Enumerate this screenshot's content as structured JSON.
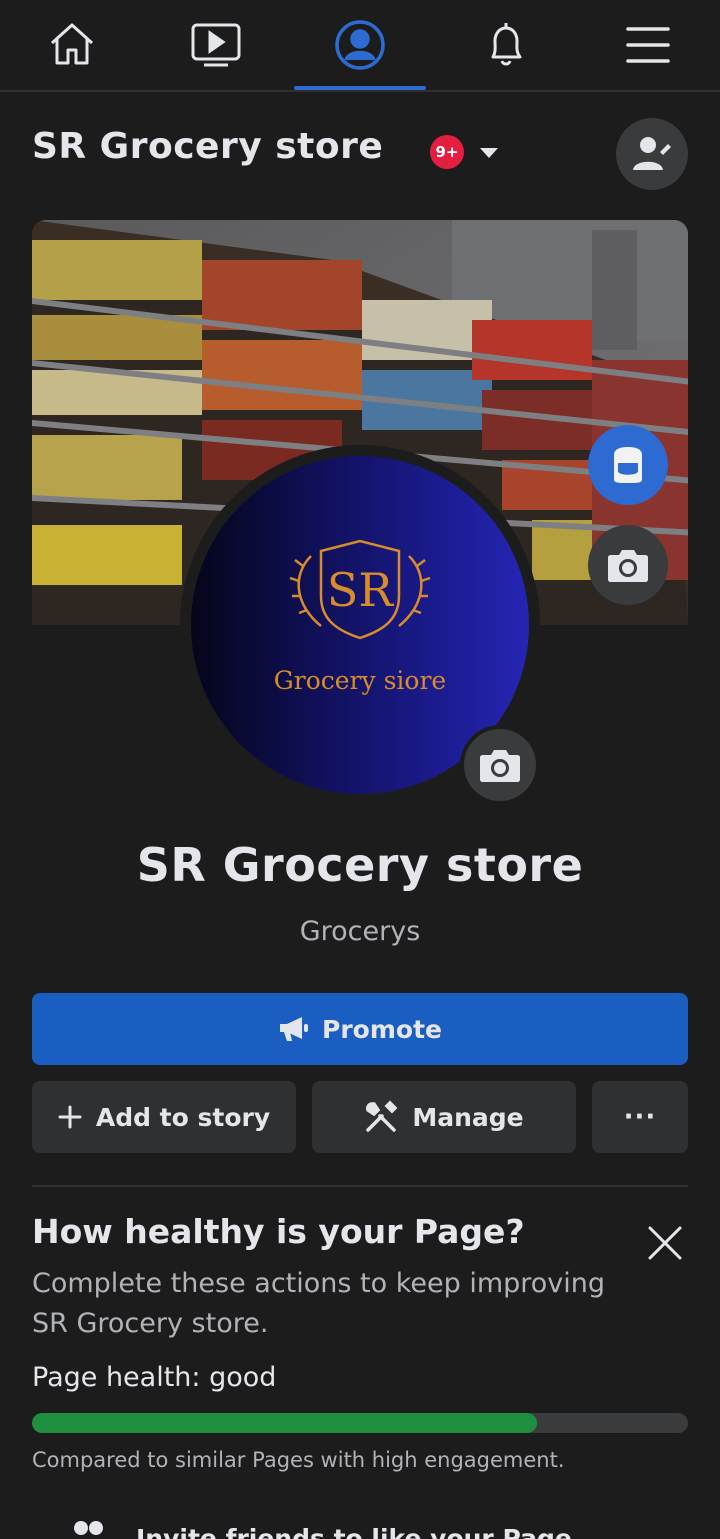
{
  "nav": {
    "items": [
      {
        "icon": "home-icon",
        "active": false
      },
      {
        "icon": "watch-video-icon",
        "active": false
      },
      {
        "icon": "profile-icon",
        "active": true
      },
      {
        "icon": "notifications-bell-icon",
        "active": false
      },
      {
        "icon": "menu-hamburger-icon",
        "active": false
      }
    ],
    "active_color": "#2d6bd3"
  },
  "header": {
    "page_name": "SR Grocery store",
    "notification_badge": "9+",
    "switch_profile_icon": "person-switch-icon"
  },
  "cover": {
    "description_icon": "avatar-icon",
    "camera_icon": "camera-icon"
  },
  "profile": {
    "logo_monogram": "SR",
    "logo_text": "Grocery siore",
    "title": "SR Grocery store",
    "category": "Grocerys",
    "camera_icon": "camera-icon"
  },
  "actions": {
    "promote_label": "Promote",
    "add_story_label": "Add to story",
    "manage_label": "Manage",
    "more_label": "···"
  },
  "health": {
    "title": "How healthy is your Page?",
    "description": "Complete these actions to keep improving SR Grocery store.",
    "status": "Page health:  good",
    "progress": 0.77,
    "compare_text": "Compared to similar Pages with high engagement.",
    "invite_text": "Invite friends to like your Page"
  },
  "colors": {
    "background": "#1c1c1d",
    "primary": "#1b5ec2",
    "badge": "#e41e3f",
    "health_good": "#1e8f3e",
    "logo_gold": "#d98c2a"
  }
}
